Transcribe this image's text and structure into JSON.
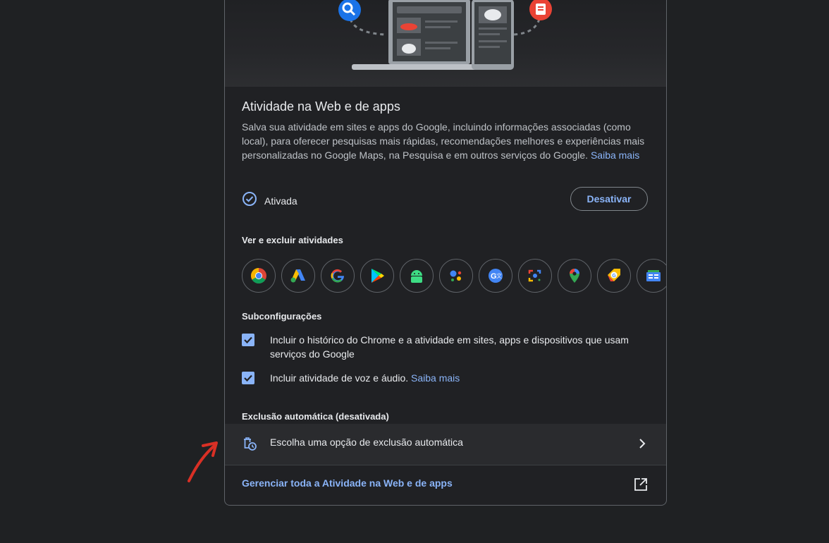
{
  "activity": {
    "title": "Atividade na Web e de apps",
    "description": "Salva sua atividade em sites e apps do Google, incluindo informações associadas (como local), para oferecer pesquisas mais rápidas, recomendações melhores e experiências mais personalizadas no Google Maps, na Pesquisa e em outros serviços do Google.",
    "learn_more": "Saiba mais",
    "status": "Ativada",
    "disable_button": "Desativar"
  },
  "view_delete": {
    "heading": "Ver e excluir atividades",
    "apps": [
      "chrome-icon",
      "google-ads-icon",
      "google-search-icon",
      "google-play-icon",
      "android-icon",
      "google-assistant-icon",
      "google-translate-icon",
      "google-lens-icon",
      "google-maps-icon",
      "google-shopping-icon",
      "google-news-icon"
    ]
  },
  "subsettings": {
    "heading": "Subconfigurações",
    "items": [
      {
        "label": "Incluir o histórico do Chrome e a atividade em sites, apps e dispositivos que usam serviços do Google",
        "checked": true
      },
      {
        "label": "Incluir atividade de voz e áudio.",
        "link": "Saiba mais",
        "checked": true
      }
    ]
  },
  "auto_delete": {
    "heading": "Exclusão automática (desativada)",
    "option_label": "Escolha uma opção de exclusão automática"
  },
  "manage_link": "Gerenciar toda a Atividade na Web e de apps",
  "colors": {
    "background": "#1f2123",
    "card": "#202124",
    "accent": "#8ab4f8",
    "annotation": "#d93025"
  }
}
